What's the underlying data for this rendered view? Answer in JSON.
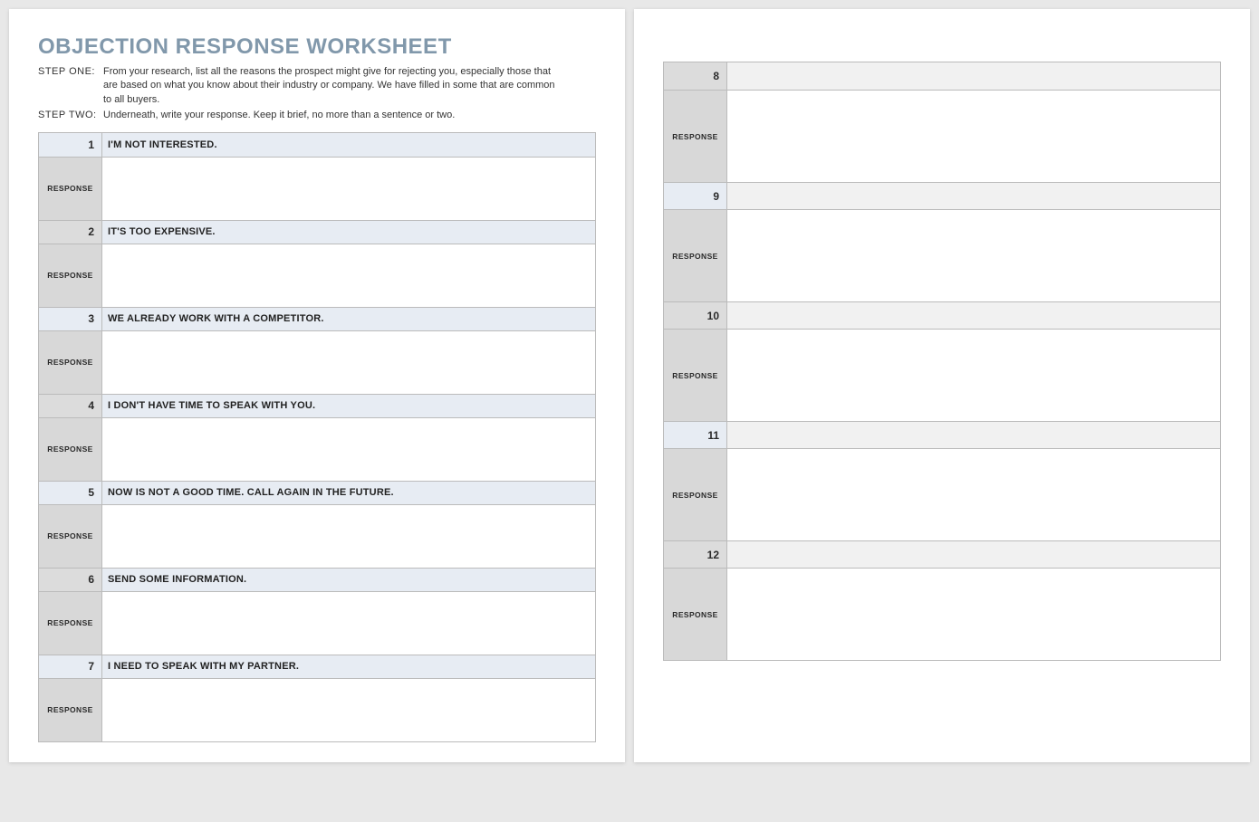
{
  "title": "OBJECTION RESPONSE WORKSHEET",
  "steps": [
    {
      "label": "STEP ONE:",
      "text": "From your research, list all the reasons the prospect might give for rejecting you, especially those that are based on what you know about their industry or company. We have filled in some that are common to all buyers."
    },
    {
      "label": "STEP TWO:",
      "text": "Underneath, write your response. Keep it brief, no more than a sentence or two."
    }
  ],
  "response_label": "RESPONSE",
  "left_items": [
    {
      "num": "1",
      "objection": "I'M NOT INTERESTED.",
      "response": ""
    },
    {
      "num": "2",
      "objection": "IT'S TOO EXPENSIVE.",
      "response": ""
    },
    {
      "num": "3",
      "objection": "WE ALREADY WORK WITH A COMPETITOR.",
      "response": ""
    },
    {
      "num": "4",
      "objection": "I DON'T HAVE TIME TO SPEAK WITH YOU.",
      "response": ""
    },
    {
      "num": "5",
      "objection": "NOW IS NOT A GOOD TIME.  CALL AGAIN IN THE FUTURE.",
      "response": ""
    },
    {
      "num": "6",
      "objection": "SEND SOME INFORMATION.",
      "response": ""
    },
    {
      "num": "7",
      "objection": "I NEED TO SPEAK WITH MY PARTNER.",
      "response": ""
    }
  ],
  "right_items": [
    {
      "num": "8",
      "objection": "",
      "response": ""
    },
    {
      "num": "9",
      "objection": "",
      "response": ""
    },
    {
      "num": "10",
      "objection": "",
      "response": ""
    },
    {
      "num": "11",
      "objection": "",
      "response": ""
    },
    {
      "num": "12",
      "objection": "",
      "response": ""
    }
  ]
}
